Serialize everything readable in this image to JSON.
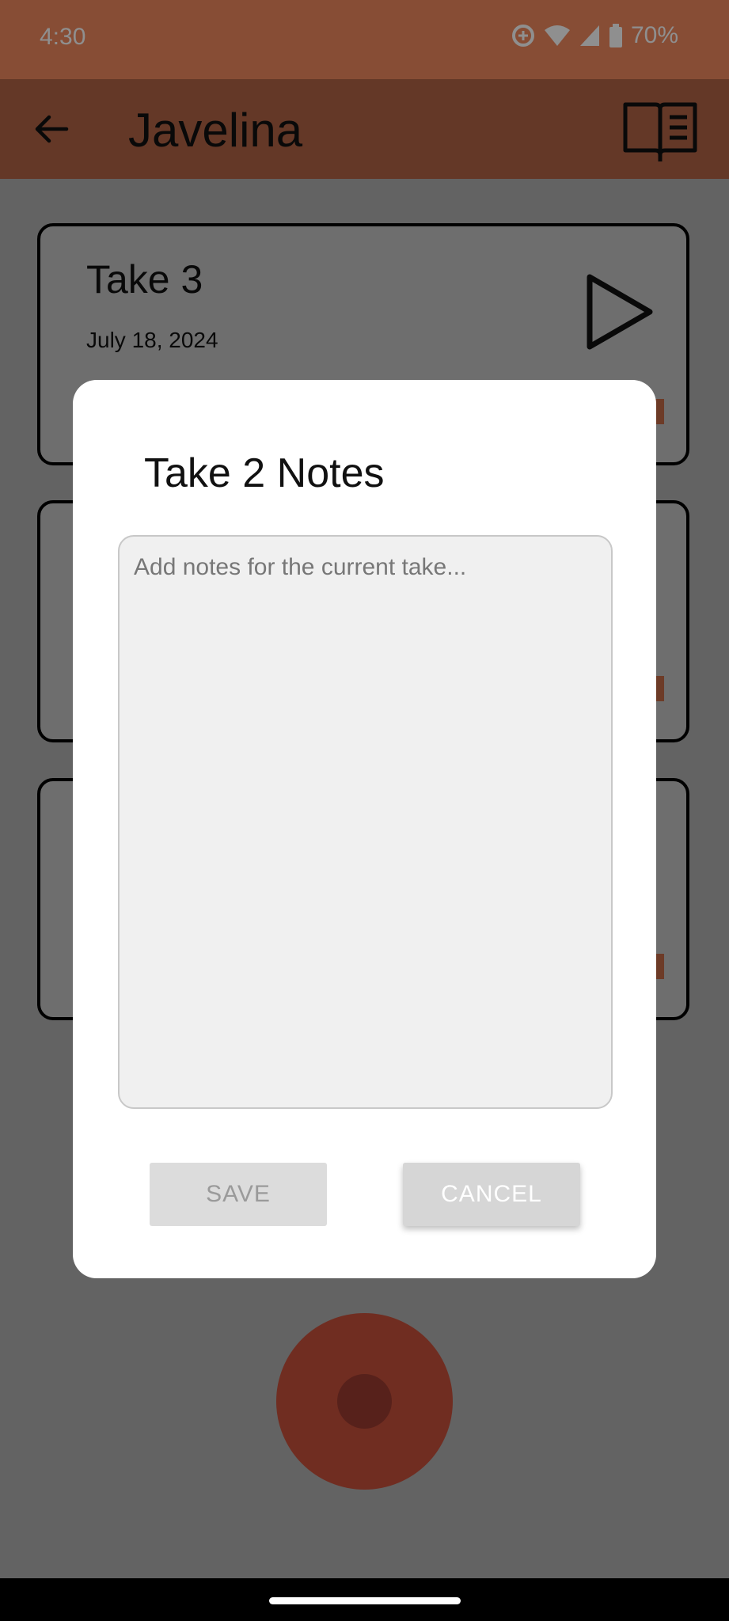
{
  "status_bar": {
    "time": "4:30",
    "battery": "70%"
  },
  "app_bar": {
    "title": "Javelina"
  },
  "takes": [
    {
      "title": "Take 3",
      "date": "July 18, 2024"
    }
  ],
  "dialog": {
    "title": "Take 2 Notes",
    "notes_placeholder": "Add notes for the current take...",
    "notes_value": "",
    "save_label": "SAVE",
    "cancel_label": "CANCEL"
  },
  "colors": {
    "status_bar": "#f0895f",
    "app_bar": "#b26446",
    "record_button": "#c8503b",
    "accent_marker": "#c26a46"
  }
}
